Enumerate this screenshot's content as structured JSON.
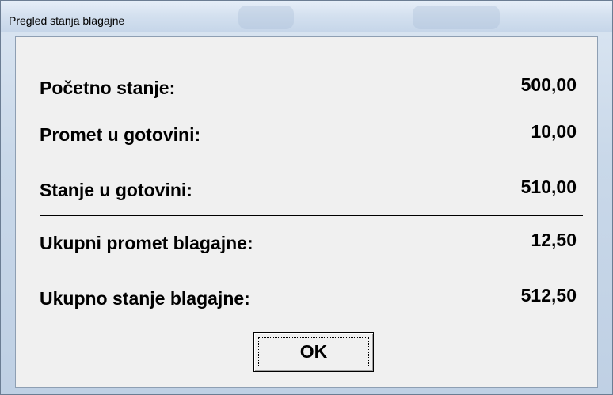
{
  "window": {
    "title": "Pregled stanja blagajne"
  },
  "rows": [
    {
      "label": "Početno stanje:",
      "value": "500,00"
    },
    {
      "label": "Promet u gotovini:",
      "value": "10,00"
    },
    {
      "label": "Stanje u gotovini:",
      "value": "510,00"
    },
    {
      "label": "Ukupni promet blagajne:",
      "value": "12,50"
    },
    {
      "label": "Ukupno stanje blagajne:",
      "value": "512,50"
    }
  ],
  "buttons": {
    "ok_label": "OK"
  },
  "colors": {
    "client_background": "#f0f0f0",
    "frame": "#c6d6e9",
    "text": "#000000"
  }
}
